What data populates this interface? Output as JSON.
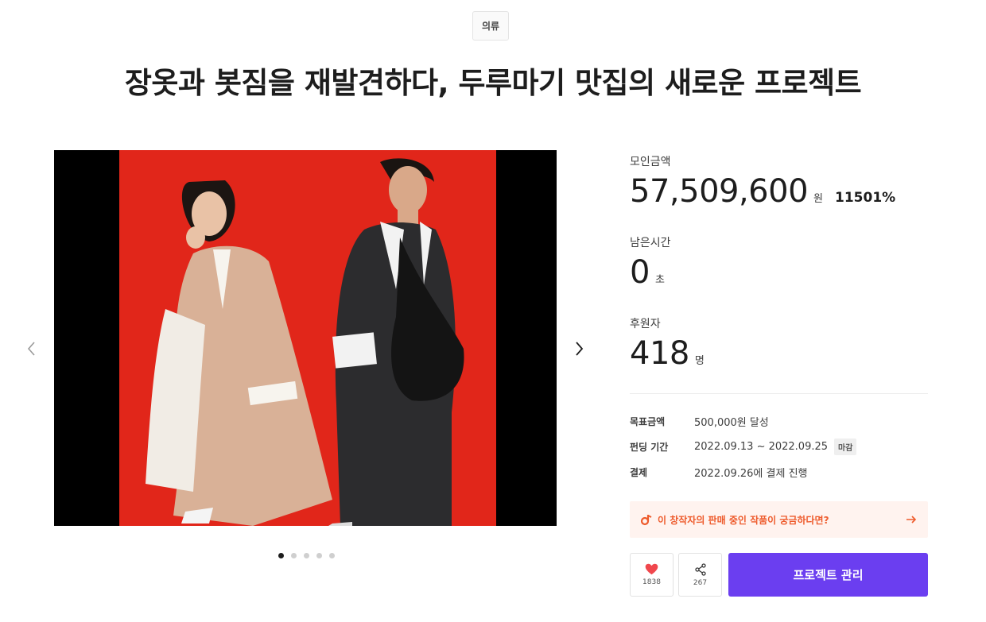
{
  "category": "의류",
  "title": "장옷과 봇짐을 재발견하다, 두루마기 맛집의 새로운 프로젝트",
  "carousel": {
    "total_slides": 5,
    "active_index": 0
  },
  "stats": {
    "raised_label": "모인금액",
    "raised_value": "57,509,600",
    "raised_unit": "원",
    "raised_percent": "11501%",
    "time_label": "남은시간",
    "time_value": "0",
    "time_unit": "초",
    "backers_label": "후원자",
    "backers_value": "418",
    "backers_unit": "명"
  },
  "info": {
    "goal_label": "목표금액",
    "goal_value": "500,000원 달성",
    "period_label": "펀딩 기간",
    "period_value": "2022.09.13 ~ 2022.09.25",
    "period_badge": "마감",
    "payment_label": "결제",
    "payment_value": "2022.09.26에 결제 진행"
  },
  "promo": {
    "text": "이 창작자의 판매 중인 작품이 궁금하다면?"
  },
  "actions": {
    "like_count": "1838",
    "share_count": "267",
    "manage_label": "프로젝트 관리"
  },
  "colors": {
    "accent": "#6b3ef0",
    "promo_text": "#ee5b2c",
    "heart": "#f0474d"
  }
}
